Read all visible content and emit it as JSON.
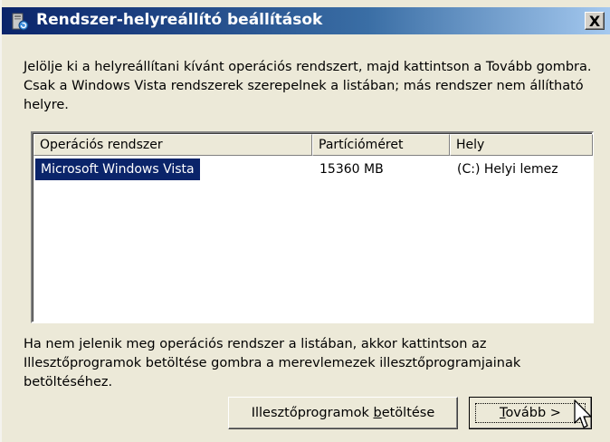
{
  "window": {
    "title": "Rendszer-helyreállító beállítások",
    "close_label": "X",
    "icon": "system-recovery-icon"
  },
  "intro_text": "Jelölje ki a helyreállítani kívánt operációs rendszert, majd kattintson a Tovább gombra. Csak a Windows Vista rendszerek szerepelnek a listában; más rendszer nem állítható helyre.",
  "list": {
    "columns": [
      "Operációs rendszer",
      "Partícióméret",
      "Hely"
    ],
    "rows": [
      {
        "os": "Microsoft Windows Vista",
        "size": "15360 MB",
        "location": "(C:) Helyi lemez",
        "selected": true
      }
    ]
  },
  "footer_text": "Ha nem jelenik meg operációs rendszer a listában, akkor kattintson az Illesztőprogramok betöltése gombra a merevlemezek illesztőprogramjainak betöltéséhez.",
  "buttons": {
    "load_drivers_pre": "Illesztőprogramok ",
    "load_drivers_key": "b",
    "load_drivers_post": "etöltése",
    "next_key": "T",
    "next_post": "ovább >"
  },
  "colors": {
    "title_start": "#0a246a",
    "title_end": "#a6caf0",
    "selection": "#0a246a",
    "dialog_bg": "#ece9d8"
  }
}
